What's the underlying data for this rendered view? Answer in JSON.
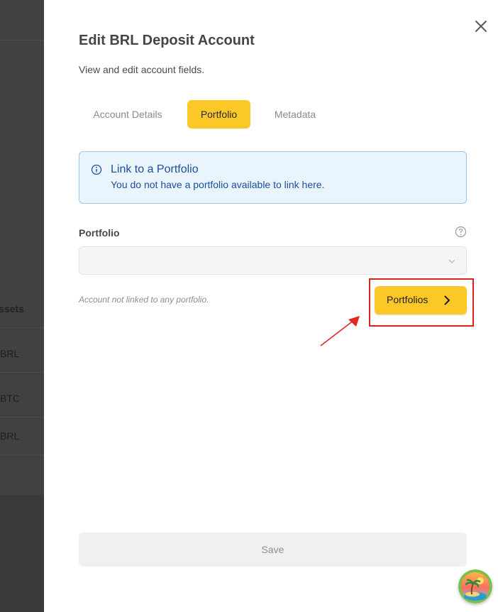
{
  "background": {
    "header_fragment": "ssets",
    "rows": [
      "BRL",
      "BTC",
      "BRL"
    ]
  },
  "dialog": {
    "title": "Edit BRL Deposit Account",
    "subtitle": "View and edit account fields.",
    "close_icon": "close-icon",
    "tabs": [
      {
        "label": "Account Details",
        "active": false
      },
      {
        "label": "Portfolio",
        "active": true
      },
      {
        "label": "Metadata",
        "active": false
      }
    ],
    "alert": {
      "icon": "info-icon",
      "title": "Link to a Portfolio",
      "body": "You do not have a portfolio available to link here."
    },
    "portfolio_field": {
      "label": "Portfolio",
      "help_icon": "help-icon",
      "value": "",
      "hint": "Account not linked to any portfolio."
    },
    "portfolios_button": {
      "label": "Portfolios",
      "icon": "chevron-right-icon"
    },
    "save_label": "Save"
  },
  "colors": {
    "accent": "#fcc827",
    "info_bg": "#eaf4fd",
    "info_text": "#1a4f9c",
    "annotation_red": "#d9231c"
  }
}
